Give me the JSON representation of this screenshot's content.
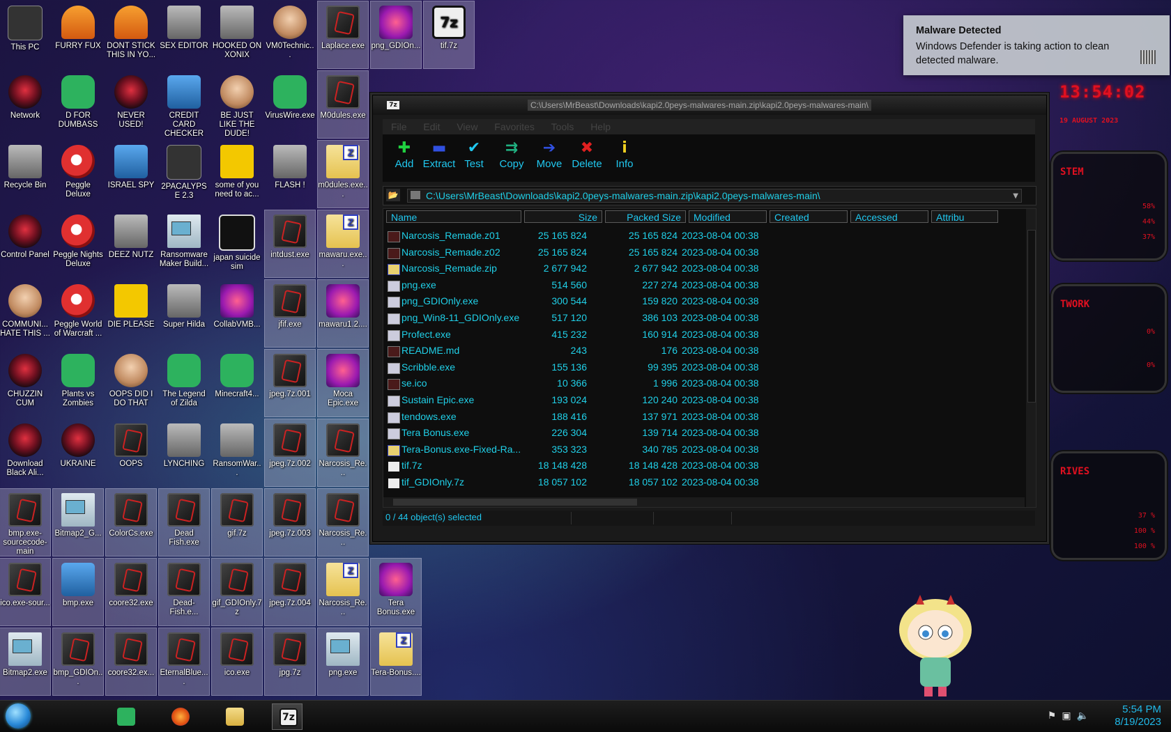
{
  "desktop": {
    "icons": [
      {
        "label": "This PC",
        "kind": "dark",
        "col": 0,
        "row": 0
      },
      {
        "label": "FURRY FUX",
        "kind": "orange",
        "col": 1,
        "row": 0
      },
      {
        "label": "DONT STICK THIS IN YO...",
        "kind": "orange",
        "col": 2,
        "row": 0
      },
      {
        "label": "SEX EDITOR",
        "kind": "gray",
        "col": 3,
        "row": 0
      },
      {
        "label": "HOOKED ON XONIX",
        "kind": "gray",
        "col": 4,
        "row": 0
      },
      {
        "label": "VM0Technic...",
        "kind": "skin",
        "col": 5,
        "row": 0
      },
      {
        "label": "Laplace.exe",
        "kind": "malw",
        "col": 6,
        "row": 0,
        "sel": true
      },
      {
        "label": "png_GDIOn...",
        "kind": "pink",
        "col": 7,
        "row": 0,
        "sel": true
      },
      {
        "label": "tif.7z",
        "kind": "sevenz",
        "col": 8,
        "row": 0,
        "sel": true
      },
      {
        "label": "Network",
        "kind": "red",
        "col": 0,
        "row": 1
      },
      {
        "label": "D FOR DUMBASS",
        "kind": "green",
        "col": 1,
        "row": 1
      },
      {
        "label": "NEVER USED!",
        "kind": "red",
        "col": 2,
        "row": 1
      },
      {
        "label": "CREDIT CARD CHECKER",
        "kind": "blue",
        "col": 3,
        "row": 1
      },
      {
        "label": "BE JUST LIKE THE DUDE!",
        "kind": "skin",
        "col": 4,
        "row": 1
      },
      {
        "label": "VirusWire.exe",
        "kind": "green",
        "col": 5,
        "row": 1
      },
      {
        "label": "M0dules.exe",
        "kind": "malw",
        "col": 6,
        "row": 1,
        "sel": true
      },
      {
        "label": "Recycle Bin",
        "kind": "gray",
        "col": 0,
        "row": 2
      },
      {
        "label": "Peggle Deluxe",
        "kind": "peggle",
        "col": 1,
        "row": 2
      },
      {
        "label": "ISRAEL SPY",
        "kind": "blue",
        "col": 2,
        "row": 2
      },
      {
        "label": "2PACALYPSE 2.3",
        "kind": "dark",
        "col": 3,
        "row": 2
      },
      {
        "label": "some of you need to ac...",
        "kind": "yellow",
        "col": 4,
        "row": 2
      },
      {
        "label": "FLASH !",
        "kind": "gray",
        "col": 5,
        "row": 2
      },
      {
        "label": "m0dules.exe...",
        "kind": "zip",
        "col": 6,
        "row": 2,
        "sel": true
      },
      {
        "label": "Control Panel",
        "kind": "red",
        "col": 0,
        "row": 3
      },
      {
        "label": "Peggle Nights Deluxe",
        "kind": "peggle",
        "col": 1,
        "row": 3
      },
      {
        "label": "DEEZ NUTZ",
        "kind": "gray",
        "col": 2,
        "row": 3
      },
      {
        "label": "Ransomware Maker Build...",
        "kind": "win",
        "col": 3,
        "row": 3
      },
      {
        "label": "japan suicide sim",
        "kind": "blackw",
        "col": 4,
        "row": 3
      },
      {
        "label": "intdust.exe",
        "kind": "malw",
        "col": 5,
        "row": 3,
        "sel": true
      },
      {
        "label": "mawaru.exe...",
        "kind": "zip",
        "col": 6,
        "row": 3,
        "sel": true
      },
      {
        "label": "COMMUNI... HATE THIS ...",
        "kind": "skin",
        "col": 0,
        "row": 4
      },
      {
        "label": "Peggle World of Warcraft ...",
        "kind": "peggle",
        "col": 1,
        "row": 4
      },
      {
        "label": "DIE PLEASE",
        "kind": "yellow",
        "col": 2,
        "row": 4
      },
      {
        "label": "Super Hilda",
        "kind": "gray",
        "col": 3,
        "row": 4
      },
      {
        "label": "CollabVMB...",
        "kind": "pink",
        "col": 4,
        "row": 4
      },
      {
        "label": "jfif.exe",
        "kind": "malw",
        "col": 5,
        "row": 4,
        "sel": true
      },
      {
        "label": "mawaru1.2....",
        "kind": "pink",
        "col": 6,
        "row": 4,
        "sel": true
      },
      {
        "label": "CHUZZIN CUM",
        "kind": "red",
        "col": 0,
        "row": 5
      },
      {
        "label": "Plants vs Zombies",
        "kind": "green",
        "col": 1,
        "row": 5
      },
      {
        "label": "OOPS DID I DO THAT",
        "kind": "skin",
        "col": 2,
        "row": 5
      },
      {
        "label": "The Legend of Zilda",
        "kind": "green",
        "col": 3,
        "row": 5
      },
      {
        "label": "Minecraft4...",
        "kind": "green",
        "col": 4,
        "row": 5
      },
      {
        "label": "jpeg.7z.001",
        "kind": "malw",
        "col": 5,
        "row": 5,
        "sel": true
      },
      {
        "label": "Moca Epic.exe",
        "kind": "pink",
        "col": 6,
        "row": 5,
        "sel": true
      },
      {
        "label": "Download Black Ali...",
        "kind": "red",
        "col": 0,
        "row": 6
      },
      {
        "label": "UKRAINE",
        "kind": "red",
        "col": 1,
        "row": 6
      },
      {
        "label": "OOPS",
        "kind": "malw",
        "col": 2,
        "row": 6
      },
      {
        "label": "LYNCHING",
        "kind": "gray",
        "col": 3,
        "row": 6
      },
      {
        "label": "RansomWar...",
        "kind": "gray",
        "col": 4,
        "row": 6
      },
      {
        "label": "jpeg.7z.002",
        "kind": "malw",
        "col": 5,
        "row": 6,
        "sel": true
      },
      {
        "label": "Narcosis_Re...",
        "kind": "malw",
        "col": 6,
        "row": 6,
        "sel": true
      },
      {
        "label": "bmp.exe-sourcecode-main",
        "kind": "malw",
        "col": 0,
        "row": 7,
        "sel": true
      },
      {
        "label": "Bitmap2_G...",
        "kind": "win",
        "col": 1,
        "row": 7,
        "sel": true
      },
      {
        "label": "ColorCs.exe",
        "kind": "malw",
        "col": 2,
        "row": 7,
        "sel": true
      },
      {
        "label": "Dead Fish.exe",
        "kind": "malw",
        "col": 3,
        "row": 7,
        "sel": true
      },
      {
        "label": "gif.7z",
        "kind": "malw",
        "col": 4,
        "row": 7,
        "sel": true
      },
      {
        "label": "jpeg.7z.003",
        "kind": "malw",
        "col": 5,
        "row": 7,
        "sel": true
      },
      {
        "label": "Narcosis_Re...",
        "kind": "malw",
        "col": 6,
        "row": 7,
        "sel": true
      },
      {
        "label": "ico.exe-sour...",
        "kind": "malw",
        "col": 0,
        "row": 8,
        "sel": true
      },
      {
        "label": "bmp.exe",
        "kind": "blue",
        "col": 1,
        "row": 8,
        "sel": true
      },
      {
        "label": "coore32.exe",
        "kind": "malw",
        "col": 2,
        "row": 8,
        "sel": true
      },
      {
        "label": "Dead-Fish.e...",
        "kind": "malw",
        "col": 3,
        "row": 8,
        "sel": true
      },
      {
        "label": "gif_GDIOnly.7z",
        "kind": "malw",
        "col": 4,
        "row": 8,
        "sel": true
      },
      {
        "label": "jpeg.7z.004",
        "kind": "malw",
        "col": 5,
        "row": 8,
        "sel": true
      },
      {
        "label": "Narcosis_Re...",
        "kind": "zip",
        "col": 6,
        "row": 8,
        "sel": true
      },
      {
        "label": "Tera Bonus.exe",
        "kind": "pink",
        "col": 7,
        "row": 8,
        "sel": true
      },
      {
        "label": "Bitmap2.exe",
        "kind": "win",
        "col": 0,
        "row": 9,
        "sel": true
      },
      {
        "label": "bmp_GDIOn...",
        "kind": "malw",
        "col": 1,
        "row": 9,
        "sel": true
      },
      {
        "label": "coore32.ex...",
        "kind": "malw",
        "col": 2,
        "row": 9,
        "sel": true
      },
      {
        "label": "EternalBlue....",
        "kind": "malw",
        "col": 3,
        "row": 9,
        "sel": true
      },
      {
        "label": "ico.exe",
        "kind": "malw",
        "col": 4,
        "row": 9,
        "sel": true
      },
      {
        "label": "jpg.7z",
        "kind": "malw",
        "col": 5,
        "row": 9,
        "sel": true
      },
      {
        "label": "png.exe",
        "kind": "win",
        "col": 6,
        "row": 9,
        "sel": true
      },
      {
        "label": "Tera-Bonus....",
        "kind": "zip",
        "col": 7,
        "row": 9,
        "sel": true
      }
    ]
  },
  "toast": {
    "title": "Malware Detected",
    "body": "Windows Defender is taking action to clean detected malware."
  },
  "hud": {
    "clock": "13:54:02",
    "date": "19 AUGUST 2023",
    "panels": [
      {
        "title": "STEM",
        "values": [
          "58%",
          "44%",
          "37%"
        ]
      },
      {
        "title": "TWORK",
        "values": [
          "0%",
          "0%"
        ]
      },
      {
        "title": "RIVES",
        "values": [
          "37 %",
          "100 %",
          "100 %"
        ]
      }
    ]
  },
  "window": {
    "title": "C:\\Users\\MrBeast\\Downloads\\kapi2.0peys-malwares-main.zip\\kapi2.0peys-malwares-main\\",
    "menu": [
      "File",
      "Edit",
      "View",
      "Favorites",
      "Tools",
      "Help"
    ],
    "toolbar": [
      {
        "label": "Add",
        "glyph": "✚",
        "color": "#20d040"
      },
      {
        "label": "Extract",
        "glyph": "▬",
        "color": "#3050e0"
      },
      {
        "label": "Test",
        "glyph": "✔",
        "color": "#20c8f0"
      },
      {
        "label": "Copy",
        "glyph": "⇉",
        "color": "#20b080"
      },
      {
        "label": "Move",
        "glyph": "➔",
        "color": "#3050e0"
      },
      {
        "label": "Delete",
        "glyph": "✖",
        "color": "#e02020"
      },
      {
        "label": "Info",
        "glyph": "i",
        "color": "#f0d020"
      }
    ],
    "address": "C:\\Users\\MrBeast\\Downloads\\kapi2.0peys-malwares-main.zip\\kapi2.0peys-malwares-main\\",
    "columns": [
      "Name",
      "Size",
      "Packed Size",
      "Modified",
      "Created",
      "Accessed",
      "Attribu"
    ],
    "files": [
      {
        "name": "Narcosis_Remade.z01",
        "size": "25 165 824",
        "packed": "25 165 824",
        "modified": "2023-08-04 00:38",
        "icon": "dk"
      },
      {
        "name": "Narcosis_Remade.z02",
        "size": "25 165 824",
        "packed": "25 165 824",
        "modified": "2023-08-04 00:38",
        "icon": "dk"
      },
      {
        "name": "Narcosis_Remade.zip",
        "size": "2 677 942",
        "packed": "2 677 942",
        "modified": "2023-08-04 00:38",
        "icon": "zipi"
      },
      {
        "name": "png.exe",
        "size": "514 560",
        "packed": "227 274",
        "modified": "2023-08-04 00:38",
        "icon": "exe"
      },
      {
        "name": "png_GDIOnly.exe",
        "size": "300 544",
        "packed": "159 820",
        "modified": "2023-08-04 00:38",
        "icon": "exe"
      },
      {
        "name": "png_Win8-11_GDIOnly.exe",
        "size": "517 120",
        "packed": "386 103",
        "modified": "2023-08-04 00:38",
        "icon": "exe"
      },
      {
        "name": "Profect.exe",
        "size": "415 232",
        "packed": "160 914",
        "modified": "2023-08-04 00:38",
        "icon": "exe"
      },
      {
        "name": "README.md",
        "size": "243",
        "packed": "176",
        "modified": "2023-08-04 00:38",
        "icon": "dk"
      },
      {
        "name": "Scribble.exe",
        "size": "155 136",
        "packed": "99 395",
        "modified": "2023-08-04 00:38",
        "icon": "exe"
      },
      {
        "name": "se.ico",
        "size": "10 366",
        "packed": "1 996",
        "modified": "2023-08-04 00:38",
        "icon": "dk"
      },
      {
        "name": "Sustain Epic.exe",
        "size": "193 024",
        "packed": "120 240",
        "modified": "2023-08-04 00:38",
        "icon": "exe"
      },
      {
        "name": "tendows.exe",
        "size": "188 416",
        "packed": "137 971",
        "modified": "2023-08-04 00:38",
        "icon": "exe"
      },
      {
        "name": "Tera Bonus.exe",
        "size": "226 304",
        "packed": "139 714",
        "modified": "2023-08-04 00:38",
        "icon": "exe"
      },
      {
        "name": "Tera-Bonus.exe-Fixed-Ra...",
        "size": "353 323",
        "packed": "340 785",
        "modified": "2023-08-04 00:38",
        "icon": "zipi"
      },
      {
        "name": "tif.7z",
        "size": "18 148 428",
        "packed": "18 148 428",
        "modified": "2023-08-04 00:38",
        "icon": "svz"
      },
      {
        "name": "tif_GDIOnly.7z",
        "size": "18 057 102",
        "packed": "18 057 102",
        "modified": "2023-08-04 00:38",
        "icon": "svz"
      }
    ],
    "status": "0 / 44 object(s) selected"
  },
  "taskbar": {
    "time": "5:54 PM",
    "date": "8/19/2023",
    "apps": [
      {
        "name": "notes-app",
        "color": "#2db25e"
      },
      {
        "name": "firefox",
        "color": "#f07a20"
      },
      {
        "name": "file-explorer",
        "color": "#e8c860"
      },
      {
        "name": "7zip",
        "color": "#eeeeee",
        "label": "7z",
        "active": true
      }
    ]
  }
}
